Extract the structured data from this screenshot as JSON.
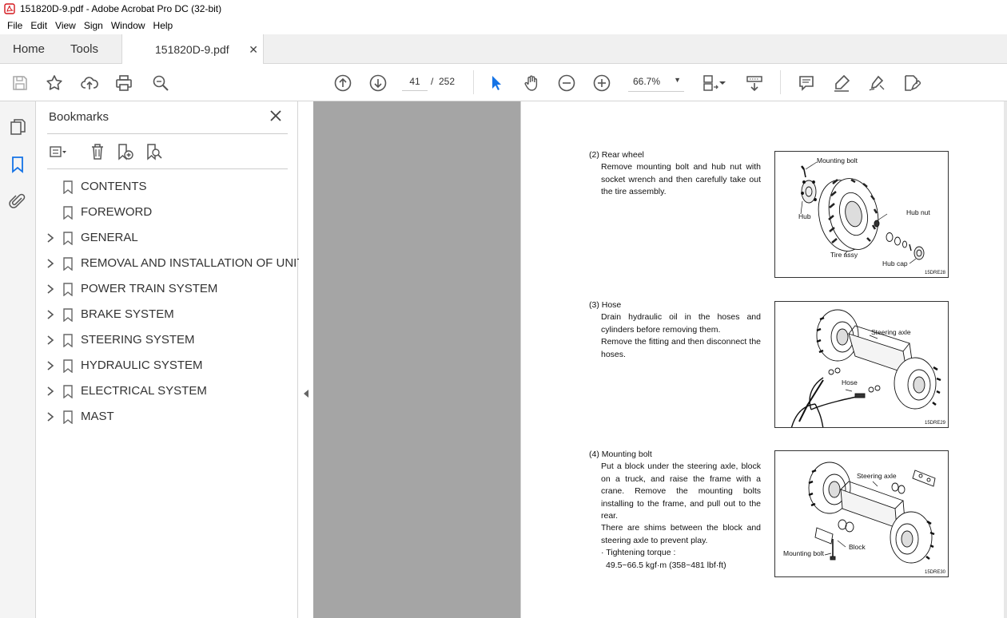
{
  "window": {
    "title": "151820D-9.pdf - Adobe Acrobat Pro DC (32-bit)"
  },
  "menu": [
    "File",
    "Edit",
    "View",
    "Sign",
    "Window",
    "Help"
  ],
  "tabs": {
    "home": "Home",
    "tools": "Tools",
    "document": "151820D-9.pdf"
  },
  "toolbar": {
    "current_page": "41",
    "page_separator": "/",
    "total_pages": "252",
    "zoom": "66.7%"
  },
  "bookmarks": {
    "title": "Bookmarks",
    "items": [
      {
        "label": "CONTENTS",
        "expandable": false
      },
      {
        "label": "FOREWORD",
        "expandable": false
      },
      {
        "label": "GENERAL",
        "expandable": true
      },
      {
        "label": "REMOVAL AND INSTALLATION OF UNIT",
        "expandable": true
      },
      {
        "label": "POWER TRAIN SYSTEM",
        "expandable": true
      },
      {
        "label": "BRAKE SYSTEM",
        "expandable": true
      },
      {
        "label": "STEERING SYSTEM",
        "expandable": true
      },
      {
        "label": "HYDRAULIC SYSTEM",
        "expandable": true
      },
      {
        "label": "ELECTRICAL SYSTEM",
        "expandable": true
      },
      {
        "label": "MAST",
        "expandable": true
      }
    ]
  },
  "document": {
    "sections": [
      {
        "heading": "(2) Rear wheel",
        "body": [
          "Remove mounting bolt and hub nut with socket wrench and then carefully take out the tire assembly."
        ],
        "figure": {
          "code": "15DRE28",
          "labels": {
            "mounting_bolt": "Mounting bolt",
            "hub": "Hub",
            "hub_nut": "Hub nut",
            "tire_assy": "Tire assy",
            "hub_cap": "Hub cap"
          }
        }
      },
      {
        "heading": "(3) Hose",
        "body": [
          "Drain hydraulic oil in the hoses and cylinders before removing them.",
          "Remove the fitting and then disconnect the hoses."
        ],
        "figure": {
          "code": "15DRE29",
          "labels": {
            "steering_axle": "Steering axle",
            "hose": "Hose"
          }
        }
      },
      {
        "heading": "(4) Mounting bolt",
        "body": [
          "Put a block under the steering axle, block on a truck, and raise the frame with a crane.  Remove the mounting bolts installing to the frame, and pull out to the rear.",
          "There are shims between the block and steering axle to prevent play.",
          "· Tightening torque :",
          "  49.5~66.5 kgf·m (358~481 lbf·ft)"
        ],
        "figure": {
          "code": "15DRE30",
          "labels": {
            "steering_axle": "Steering axle",
            "block": "Block",
            "mounting_bolt": "Mounting bolt"
          }
        }
      }
    ]
  },
  "colors": {
    "accent": "#1473e6",
    "pdf_red": "#d4161c",
    "gray_bg": "#a5a5a5"
  }
}
